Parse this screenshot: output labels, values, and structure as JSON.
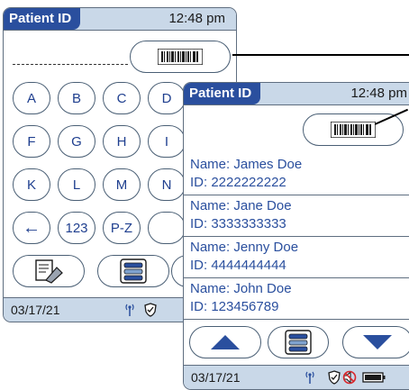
{
  "screen1": {
    "title": "Patient ID",
    "time": "12:48 pm",
    "keys_row1": [
      "A",
      "B",
      "C",
      "D"
    ],
    "keys_row2": [
      "F",
      "G",
      "H",
      "I"
    ],
    "keys_row3": [
      "K",
      "L",
      "M",
      "N"
    ],
    "keys_row4": [
      "←",
      "123",
      "P-Z"
    ],
    "date": "03/17/21"
  },
  "screen2": {
    "title": "Patient ID",
    "time": "12:48 pm",
    "patients": [
      {
        "name": "Name: James Doe",
        "id": "ID: 2222222222"
      },
      {
        "name": "Name: Jane Doe",
        "id": "ID: 3333333333"
      },
      {
        "name": "Name: Jenny Doe",
        "id": "ID: 4444444444"
      },
      {
        "name": "Name: John Doe",
        "id": "ID: 123456789"
      }
    ],
    "date": "03/17/21"
  },
  "colors": {
    "accent": "#2a4f9e",
    "bar": "#c9d8e8",
    "text": "#1f3f8f",
    "status_red": "#d8262b"
  },
  "icons": [
    "barcode-icon",
    "edit-icon",
    "list-icon",
    "signal-icon",
    "shield-icon",
    "no-sound-icon",
    "battery-icon",
    "up-arrow-icon",
    "down-arrow-icon"
  ]
}
